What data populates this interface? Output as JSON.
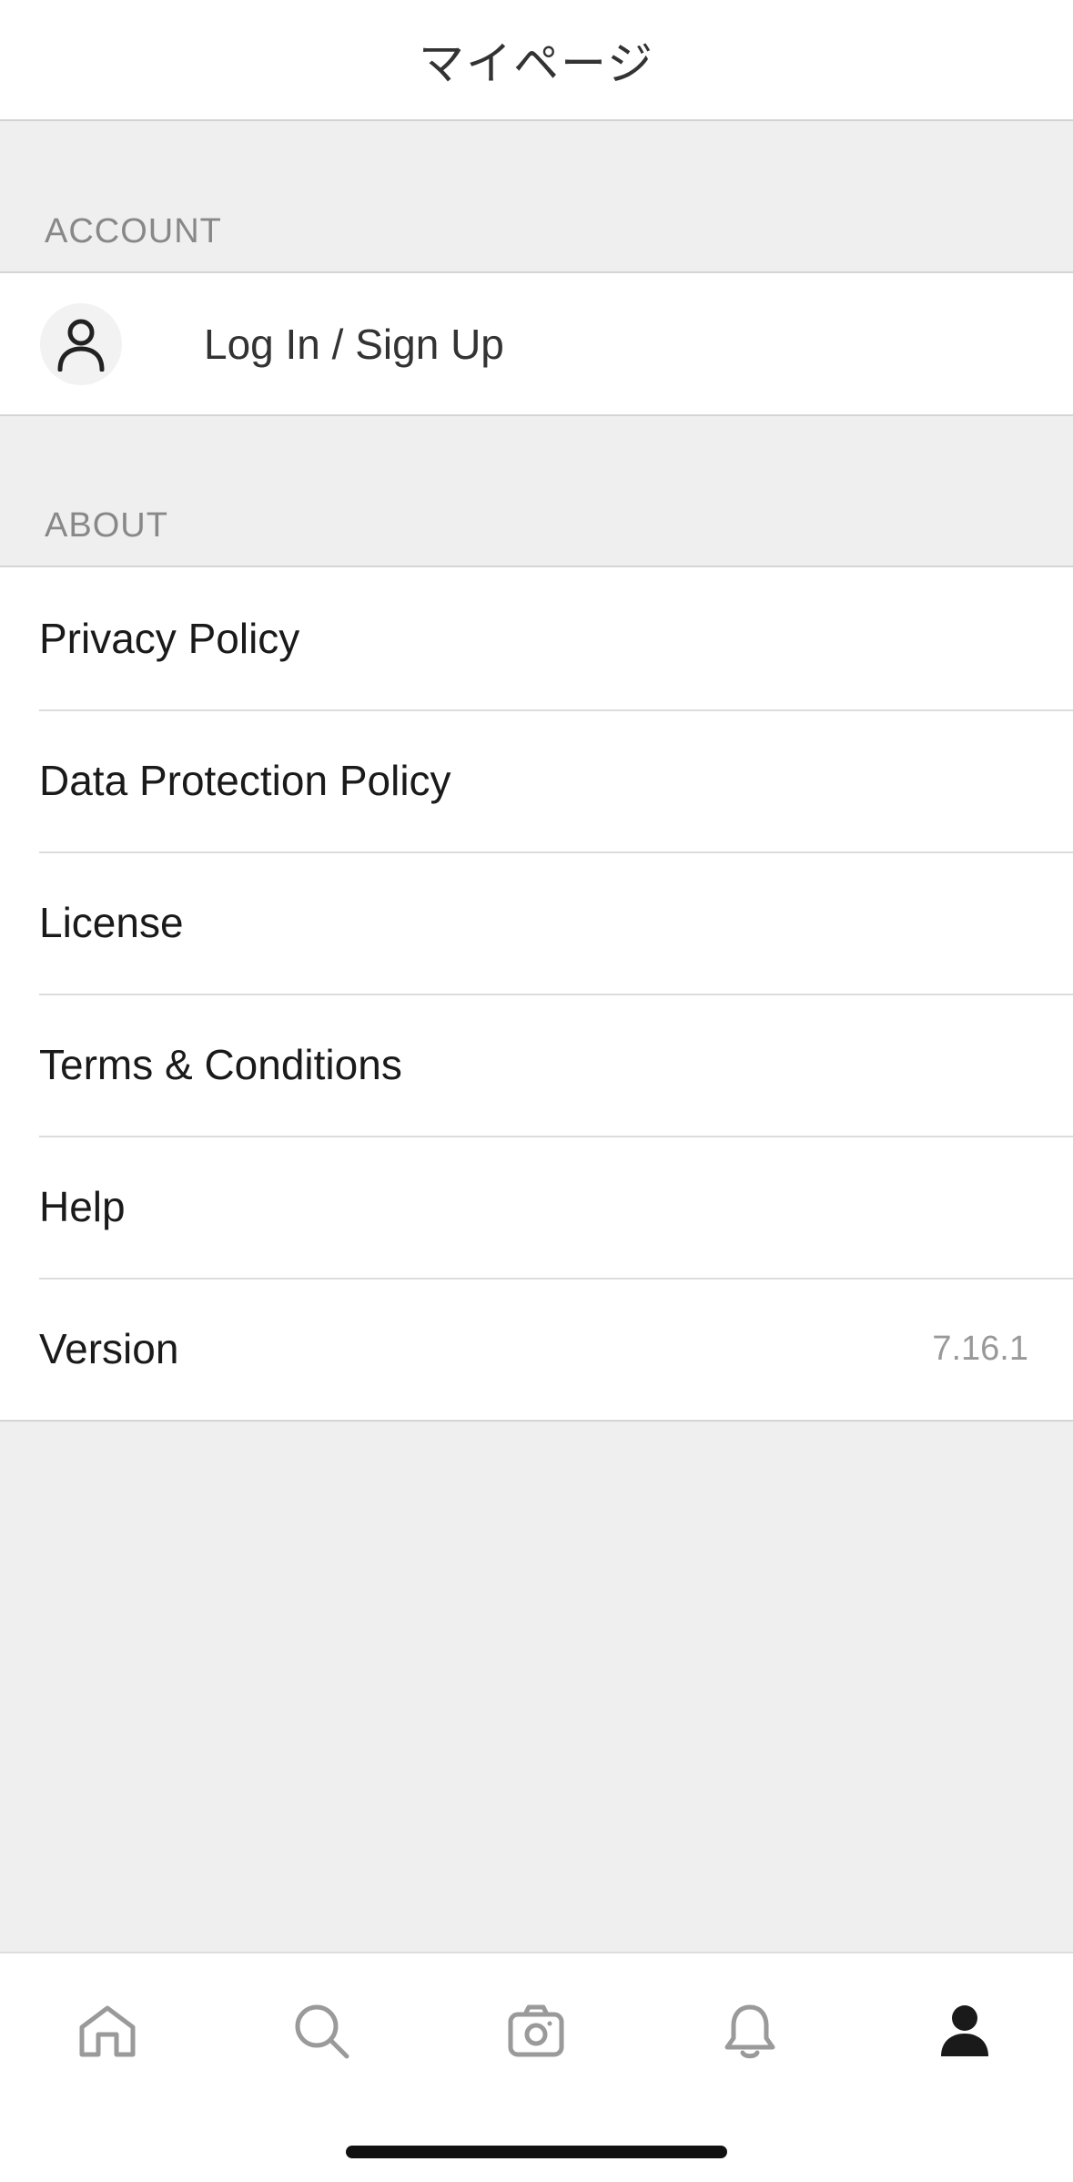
{
  "header": {
    "title": "マイページ"
  },
  "sections": {
    "account": {
      "header": "ACCOUNT",
      "login_label": "Log In / Sign Up",
      "avatar_icon": "person-outline-icon"
    },
    "about": {
      "header": "ABOUT",
      "items": [
        {
          "label": "Privacy Policy",
          "value": ""
        },
        {
          "label": "Data Protection Policy",
          "value": ""
        },
        {
          "label": "License",
          "value": ""
        },
        {
          "label": "Terms & Conditions",
          "value": ""
        },
        {
          "label": "Help",
          "value": ""
        },
        {
          "label": "Version",
          "value": "7.16.1"
        }
      ]
    }
  },
  "tab_bar": {
    "tabs": [
      {
        "icon": "home-icon",
        "selected": false
      },
      {
        "icon": "search-icon",
        "selected": false
      },
      {
        "icon": "camera-icon",
        "selected": false
      },
      {
        "icon": "bell-icon",
        "selected": false
      },
      {
        "icon": "person-icon",
        "selected": true
      }
    ],
    "selected_color": "#1a1a1a",
    "unselected_color": "#9a9a9a"
  },
  "colors": {
    "background": "#efefef",
    "surface": "#ffffff",
    "section_header_text": "#888888",
    "version_text": "#999999"
  }
}
